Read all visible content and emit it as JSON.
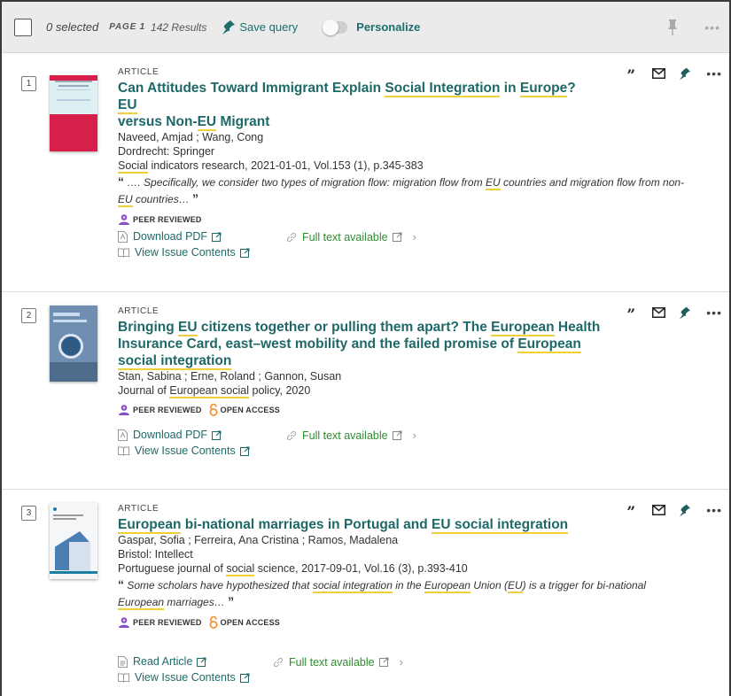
{
  "toolbar": {
    "selected": "0 selected",
    "page_label": "PAGE 1",
    "results": "142 Results",
    "save_query": "Save query",
    "personalize": "Personalize"
  },
  "records": [
    {
      "number": "1",
      "type": "ARTICLE",
      "authors": "Naveed, Amjad ; Wang, Cong",
      "publisher": "Dordrecht: Springer",
      "source_rest": " indicators research, 2021-01-01, Vol.153 (1), p.345-383",
      "badge_peer": "PEER REVIEWED",
      "link1": "Download PDF",
      "fulltext": "Full text available",
      "issue": "View Issue Contents"
    },
    {
      "number": "2",
      "type": "ARTICLE",
      "authors": "Stan, Sabina ; Erne, Roland ; Gannon, Susan",
      "badge_peer": "PEER REVIEWED",
      "badge_oa": "OPEN ACCESS",
      "link1": "Download PDF",
      "fulltext": "Full text available",
      "issue": "View Issue Contents"
    },
    {
      "number": "3",
      "type": "ARTICLE",
      "authors": "Gaspar, Sofia ; Ferreira, Ana Cristina ; Ramos, Madalena",
      "publisher": "Bristol: Intellect",
      "badge_peer": "PEER REVIEWED",
      "badge_oa": "OPEN ACCESS",
      "link1": "Read Article",
      "fulltext": "Full text available",
      "issue": "View Issue Contents"
    }
  ],
  "text": {
    "r1_t1": "Can Attitudes Toward Immigrant Explain ",
    "r1_t2": "Social Integration",
    "r1_t3": " in ",
    "r1_t4": "Europe",
    "r1_t5": "? ",
    "r1_t6": "EU",
    "r1_t7": "versus Non-",
    "r1_t8": "EU",
    "r1_t9": " Migrant",
    "r1_src_hl": "Social",
    "r1_s1": "…. Specifically, we consider two types of migration flow: migration flow from ",
    "r1_s2": "EU",
    "r1_s3": " countries and migration flow from non-",
    "r1_s4": "EU",
    "r1_s5": " countries…",
    "r2_t1": "Bringing ",
    "r2_t2": "EU",
    "r2_t3": " citizens together or pulling them apart? The ",
    "r2_t4": "European",
    "r2_t5": " Health Insurance Card, east–west mobility and the failed promise of ",
    "r2_t6": "European",
    "r2_t7": "social integration",
    "r2_j1": "Journal of ",
    "r2_j2": "European social",
    "r2_j3": " policy, 2020",
    "r3_t1": "European",
    "r3_t2": " bi-national marriages in Portugal and ",
    "r3_t3": "EU social integration",
    "r3_src1": "Portuguese journal of ",
    "r3_src2": "social",
    "r3_src3": " science, 2017-09-01, Vol.16 (3), p.393-410",
    "r3_s1": "Some scholars have hypothesized that ",
    "r3_s2": "social integration",
    "r3_s3": " in the ",
    "r3_s4": "European",
    "r3_s5": " Union (",
    "r3_s6": "EU",
    "r3_s7": ") is a trigger for bi-national ",
    "r3_s8": "European",
    "r3_s9": " marriages…"
  },
  "glyphs": {
    "open_quote": "“",
    "close_quote": "”",
    "chevron": "›",
    "ellipsis": "•••"
  },
  "icons": [
    "checkbox-icon",
    "pin-icon",
    "quote-icon",
    "mail-icon",
    "more-icon",
    "pdf-icon",
    "book-icon",
    "link-icon",
    "external-link-icon",
    "peer-reviewed-icon",
    "open-access-icon",
    "article-icon"
  ],
  "colors": {
    "link_teal": "#1e6868",
    "highlight": "#f0cf3a",
    "fulltext_green": "#2e8b2e",
    "peer_purple": "#8a4fc9",
    "open_access_orange": "#f08a24"
  }
}
